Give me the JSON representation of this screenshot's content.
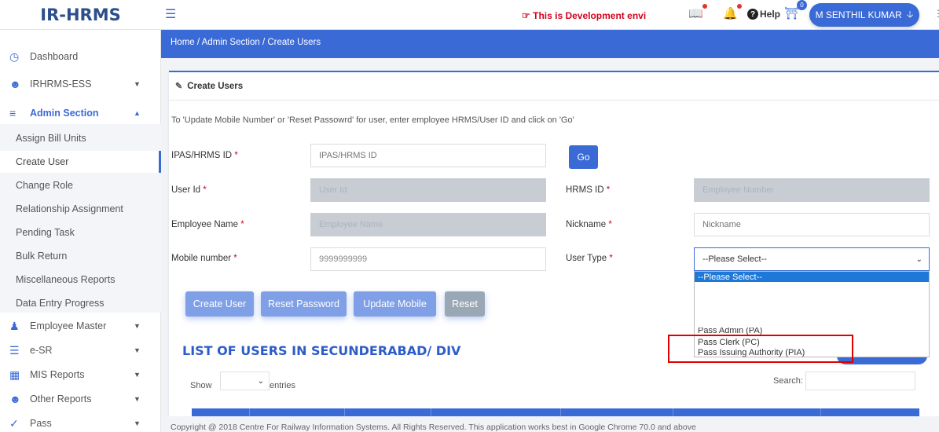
{
  "brand": "IR-HRMS",
  "topbar": {
    "dev_notice": "This is Development envi",
    "help_label": "Help",
    "notif_count": "0",
    "user_name": "M SENTHIL KUMAR"
  },
  "breadcrumb": "Home / Admin Section / Create Users",
  "sidebar": {
    "items": [
      {
        "label": "Dashboard"
      },
      {
        "label": "IRHRMS-ESS"
      },
      {
        "label": "Admin Section"
      },
      {
        "label": "Employee Master"
      },
      {
        "label": "e-SR"
      },
      {
        "label": "MIS Reports"
      },
      {
        "label": "Other Reports"
      },
      {
        "label": "Pass"
      }
    ],
    "sub_items": [
      {
        "label": "Assign Bill Units"
      },
      {
        "label": "Create User"
      },
      {
        "label": "Change Role"
      },
      {
        "label": "Relationship Assignment"
      },
      {
        "label": "Pending Task"
      },
      {
        "label": "Bulk Return"
      },
      {
        "label": "Miscellaneous Reports"
      },
      {
        "label": "Data Entry Progress"
      }
    ]
  },
  "card": {
    "title": "Create Users",
    "note": "To 'Update Mobile Number' or 'Reset Passowrd' for user, enter employee HRMS/User ID and click on 'Go'"
  },
  "form": {
    "ipas_label": "IPAS/HRMS ID",
    "ipas_placeholder": "IPAS/HRMS ID",
    "go_label": "Go",
    "userid_label": "User Id",
    "userid_placeholder": "User Id",
    "hrmsid_label": "HRMS ID",
    "hrmsid_placeholder": "Employee Number",
    "empname_label": "Employee Name",
    "empname_placeholder": "Employee Name",
    "nickname_label": "Nickname",
    "nickname_placeholder": "Nickname",
    "mobile_label": "Mobile number",
    "mobile_value": "9999999999",
    "usertype_label": "User Type",
    "usertype_value": "--Please Select--",
    "required_mark": "*"
  },
  "dropdown": {
    "options": [
      "--Please Select--",
      "Pass Admin (PA)",
      "Pass Clerk (PC)",
      "Pass Issuing Authority (PIA)"
    ]
  },
  "buttons": {
    "create": "Create User",
    "reset_password": "Reset Password",
    "update_mobile": "Update Mobile",
    "reset": "Reset"
  },
  "list": {
    "title": "LIST OF USERS IN SECUNDERABAD/ DIV",
    "show": "Show",
    "entries": "entries",
    "search": "Search:"
  },
  "footer": "Copyright @ 2018 Centre For Railway Information Systems. All Rights Reserved. This application works best in Google Chrome 70.0 and above",
  "colors": {
    "primary": "#3a6ad6",
    "brand": "#2c4f8c",
    "danger": "#e00000"
  }
}
